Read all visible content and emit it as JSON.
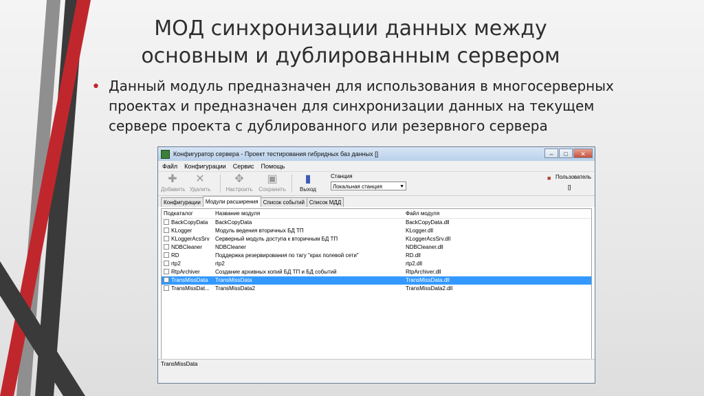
{
  "slide": {
    "title": "МОД синхронизации данных между основным и дублированным сервером",
    "bullet": "Данный модуль предназначен для использования в многосерверных проектах и предназначен для синхронизации данных на текущем сервере проекта с дублированного или резервного сервера",
    "colors": {
      "accent_red": "#c0272d",
      "dark_stripe": "#3a3a3a",
      "grey_stripe": "#8a8a8a"
    }
  },
  "window": {
    "title": "Конфигуратор сервера - Проект тестирования гибридных баз данных []",
    "controls": {
      "minimize": "–",
      "maximize": "□",
      "close": "✕"
    },
    "menu": [
      "Файл",
      "Конфигурации",
      "Сервис",
      "Помощь"
    ],
    "toolbar": {
      "add": {
        "label": "Добавить",
        "icon": "plus-icon"
      },
      "delete": {
        "label": "Удалить",
        "icon": "x-icon"
      },
      "configure": {
        "label": "Настроить",
        "icon": "puzzle-icon"
      },
      "save": {
        "label": "Сохранить",
        "icon": "floppy-icon"
      },
      "exit": {
        "label": "Выход",
        "icon": "door-exit-icon"
      }
    },
    "station": {
      "label": "Станция",
      "value": "Локальная станция"
    },
    "user": {
      "label": "Пользователь",
      "value": "[]"
    },
    "tabs": [
      "Конфигурации",
      "Модули расширения",
      "Список событий",
      "Список МДД"
    ],
    "active_tab": "Модули расширения",
    "table": {
      "columns": [
        "Подкаталог",
        "Название модуля",
        "Файл модуля"
      ],
      "rows": [
        {
          "dir": "BackCopyData",
          "name": "BackCopyData",
          "file": "BackCopyData.dll"
        },
        {
          "dir": "KLogger",
          "name": "Модуль ведения вторичных БД ТП",
          "file": "KLogger.dll"
        },
        {
          "dir": "KLoggerAcsSrv",
          "name": "Серверный модуль доступа к вторичным БД ТП",
          "file": "KLoggerAcsSrv.dll"
        },
        {
          "dir": "NDBCleaner",
          "name": "NDBCleaner",
          "file": "NDBCleaner.dll"
        },
        {
          "dir": "RD",
          "name": "Поддержка резервирования по тагу \"крах полевой сети\"",
          "file": "RD.dll"
        },
        {
          "dir": "rtp2",
          "name": "rtp2",
          "file": "rtp2.dll"
        },
        {
          "dir": "RtpArchiver",
          "name": "Создание архивных копий БД ТП и БД событий",
          "file": "RtpArchiver.dll"
        },
        {
          "dir": "TransMissData",
          "name": "TransMissData",
          "file": "TransMissData.dll"
        },
        {
          "dir": "TransMissDat...",
          "name": "TransMissData2",
          "file": "TransMissData2.dll"
        }
      ],
      "selected_row": 7
    },
    "status_text": "TransMissData"
  }
}
